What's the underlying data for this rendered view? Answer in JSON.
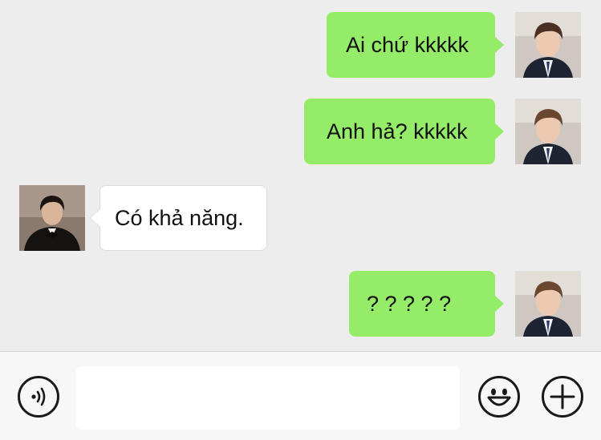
{
  "messages": [
    {
      "direction": "outgoing",
      "text": "Ai chứ kkkkk",
      "avatar": "avatar-boy-school-uniform"
    },
    {
      "direction": "outgoing",
      "text": "Anh hả? kkkkk",
      "avatar": "avatar-boy-school-uniform"
    },
    {
      "direction": "incoming",
      "text": "Có khả năng.",
      "avatar": "avatar-man-tuxedo"
    },
    {
      "direction": "outgoing",
      "text": "? ? ? ? ?",
      "avatar": "avatar-boy-school-uniform"
    }
  ],
  "input_bar": {
    "voice_icon": "voice-icon",
    "message_value": "",
    "emoji_icon": "emoji-icon",
    "add_icon": "plus-icon"
  },
  "colors": {
    "background": "#ededed",
    "outgoing_bubble": "#95ec69",
    "incoming_bubble": "#ffffff",
    "input_bar": "#f7f7f7"
  }
}
